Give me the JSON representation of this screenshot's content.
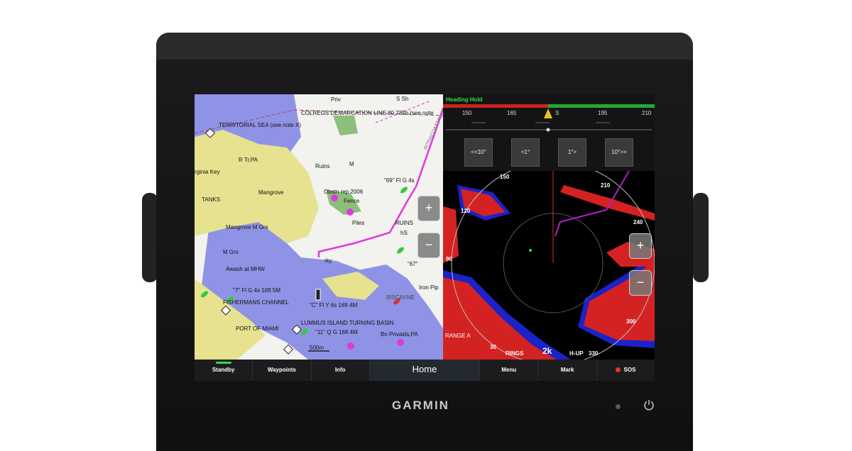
{
  "device": {
    "brand": "GARMIN",
    "icons": {
      "power": "power-icon",
      "led": "status-led"
    }
  },
  "chart": {
    "labels": [
      {
        "text": "Priv"
      },
      {
        "text": "S Sh"
      },
      {
        "text": "COLREGS DEMARCATION LINE 80.735b (see note"
      },
      {
        "text": "TERRITORIAL SEA (see note X)"
      },
      {
        "text": "R Tr,PA"
      },
      {
        "text": "rginia Key"
      },
      {
        "text": "Ruins"
      },
      {
        "text": "Mangrove"
      },
      {
        "text": "TANKS"
      },
      {
        "text": "Obstn rep 2006"
      },
      {
        "text": "Fence"
      },
      {
        "text": "Piles"
      },
      {
        "text": "RUINS"
      },
      {
        "text": "Mangrove M Grs"
      },
      {
        "text": "M Grs"
      },
      {
        "text": "Awash at MHW"
      },
      {
        "text": "\"7\" Fl G 4s 16ft 5M"
      },
      {
        "text": "FISHERMANS CHANNEL"
      },
      {
        "text": "\"C\" Fl Y 6s 16ft 4M"
      },
      {
        "text": "PORT OF MIAMI"
      },
      {
        "text": "LUMMUS ISLAND TURNING BASIN"
      },
      {
        "text": "\"11\" Q G 16ft 4M"
      },
      {
        "text": "Bn Privaids,PA"
      },
      {
        "text": "\"69\" Fl G 4s"
      },
      {
        "text": "500m"
      },
      {
        "text": "INTRACOASTAL WATERWAY"
      },
      {
        "text": "BISCAYNE"
      },
      {
        "text": "Iron Pip"
      },
      {
        "text": "\"67\""
      },
      {
        "text": "M"
      },
      {
        "text": "rky"
      },
      {
        "text": "hS"
      }
    ],
    "zoom_in": "+",
    "zoom_out": "−"
  },
  "autopilot": {
    "title": "Heading Hold",
    "scale": [
      "150",
      "165",
      "S",
      "195",
      "210"
    ],
    "buttons": [
      "<<10°",
      "<1°",
      "1°>",
      "10°>>"
    ]
  },
  "radar": {
    "bearing_labels": [
      "150",
      "210",
      "120",
      "240",
      "90",
      "300",
      "30",
      "330"
    ],
    "bottom_left": "RANGE A",
    "rings_label": "RINGS",
    "range_value": "2k",
    "orientation": "H-UP",
    "zoom_in": "+",
    "zoom_out": "−"
  },
  "tabs": {
    "standby": "Standby",
    "waypoints": "Waypoints",
    "info": "Info",
    "home": "Home",
    "menu": "Menu",
    "mark": "Mark",
    "sos": "SOS"
  },
  "colors": {
    "water_deep": "#f2f2ee",
    "water_shallow": "#8f93e6",
    "land": "#e6e290",
    "route": "#e038e0",
    "radar_echo": "#d42222",
    "radar_echo_edge": "#1a22c8",
    "ap_green": "#33dd44"
  }
}
